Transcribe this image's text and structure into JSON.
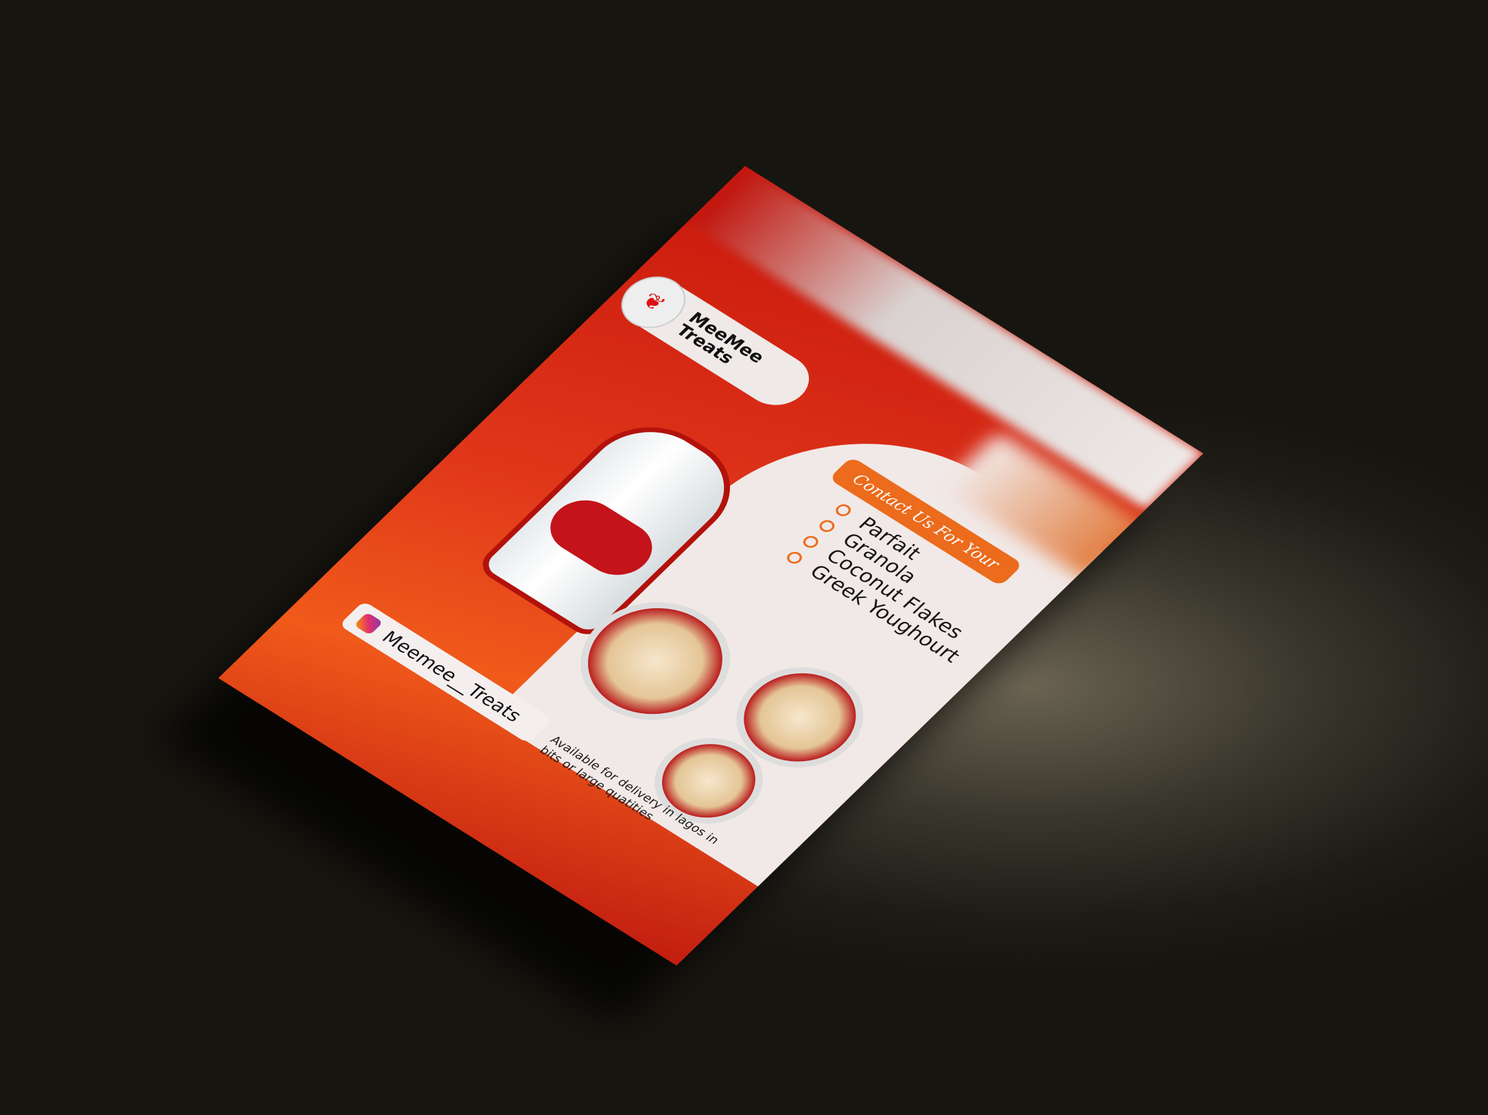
{
  "brand": {
    "name": "MeeMee Treats"
  },
  "banner": {
    "text": "Contact Us For Your"
  },
  "products": [
    "Parfait",
    "Granola",
    "Coconut Flakes",
    "Greek Youghourt"
  ],
  "social": {
    "icon": "instagram-icon",
    "handle": "Meemee__Treats"
  },
  "delivery": {
    "text": "Available for delivery in lagos in bits or large quatities"
  },
  "colors": {
    "primary": "#d9261a",
    "accent": "#ec6b1c",
    "background": "#1e1c16"
  }
}
